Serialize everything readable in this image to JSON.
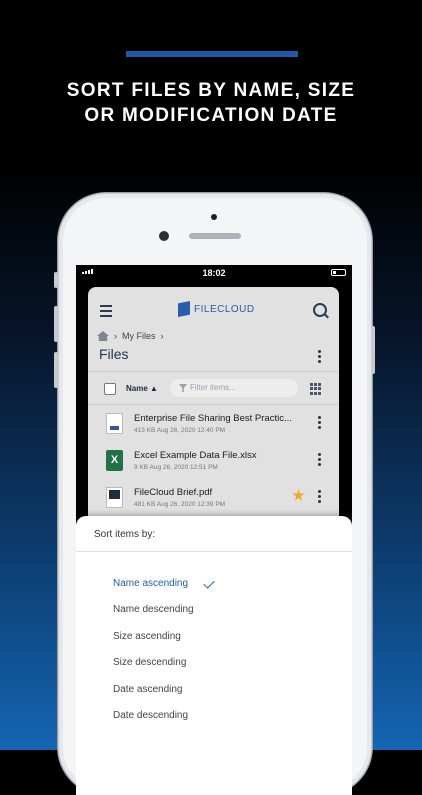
{
  "promo": {
    "headline_line1": "SORT FILES BY NAME, SIZE",
    "headline_line2": "OR MODIFICATION DATE",
    "accent_color": "#1e5aa6"
  },
  "status_bar": {
    "time": "18:02"
  },
  "app": {
    "brand": "FILECLOUD",
    "brand_color": "#2a5ca8",
    "breadcrumb": {
      "home_icon": "home-icon",
      "items": [
        "My Files"
      ]
    },
    "page_title": "Files",
    "toolbar": {
      "sort_label": "Name",
      "sort_indicator": "▲",
      "filter_placeholder": "Filter items..."
    },
    "files": [
      {
        "name": "Enterprise File Sharing Best Practic...",
        "meta": "413 KB Aug 26, 2020 12:40 PM",
        "type": "document",
        "starred": false
      },
      {
        "name": "Excel Example Data File.xlsx",
        "meta": "9 KB Aug 26, 2020 12:51 PM",
        "type": "excel",
        "icon_letter": "X",
        "starred": false
      },
      {
        "name": "FileCloud Brief.pdf",
        "meta": "481 KB Aug 26, 2020 12:39 PM",
        "type": "pdf",
        "starred": true
      }
    ]
  },
  "sort_sheet": {
    "title": "Sort items by:",
    "options": [
      {
        "label": "Name ascending",
        "selected": true
      },
      {
        "label": "Name descending",
        "selected": false
      },
      {
        "label": "Size ascending",
        "selected": false
      },
      {
        "label": "Size descending",
        "selected": false
      },
      {
        "label": "Date ascending",
        "selected": false
      },
      {
        "label": "Date descending",
        "selected": false
      }
    ],
    "selected_color": "#1f5ea8"
  }
}
